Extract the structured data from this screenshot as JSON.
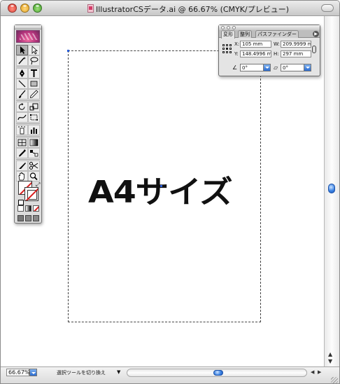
{
  "window": {
    "title": "IllustratorCSデータ.ai @ 66.67% (CMYK/プレビュー)"
  },
  "artboard": {
    "text": "A4サイズ"
  },
  "transform_panel": {
    "tabs": [
      "変形",
      "整列",
      "パスファインダー"
    ],
    "x_label": "X:",
    "x_value": "105 mm",
    "y_label": "Y:",
    "y_value": "148.4996 mm",
    "w_label": "W:",
    "w_value": "209.9999 mm",
    "h_label": "H:",
    "h_value": "297 mm",
    "rotate_value": "0°",
    "shear_value": "0°"
  },
  "statusbar": {
    "zoom": "66.67%",
    "status_text": "選択ツールを切り換え"
  },
  "colors": {
    "accent": "#2a6bd0",
    "none_swatch": "#d81e1e"
  }
}
